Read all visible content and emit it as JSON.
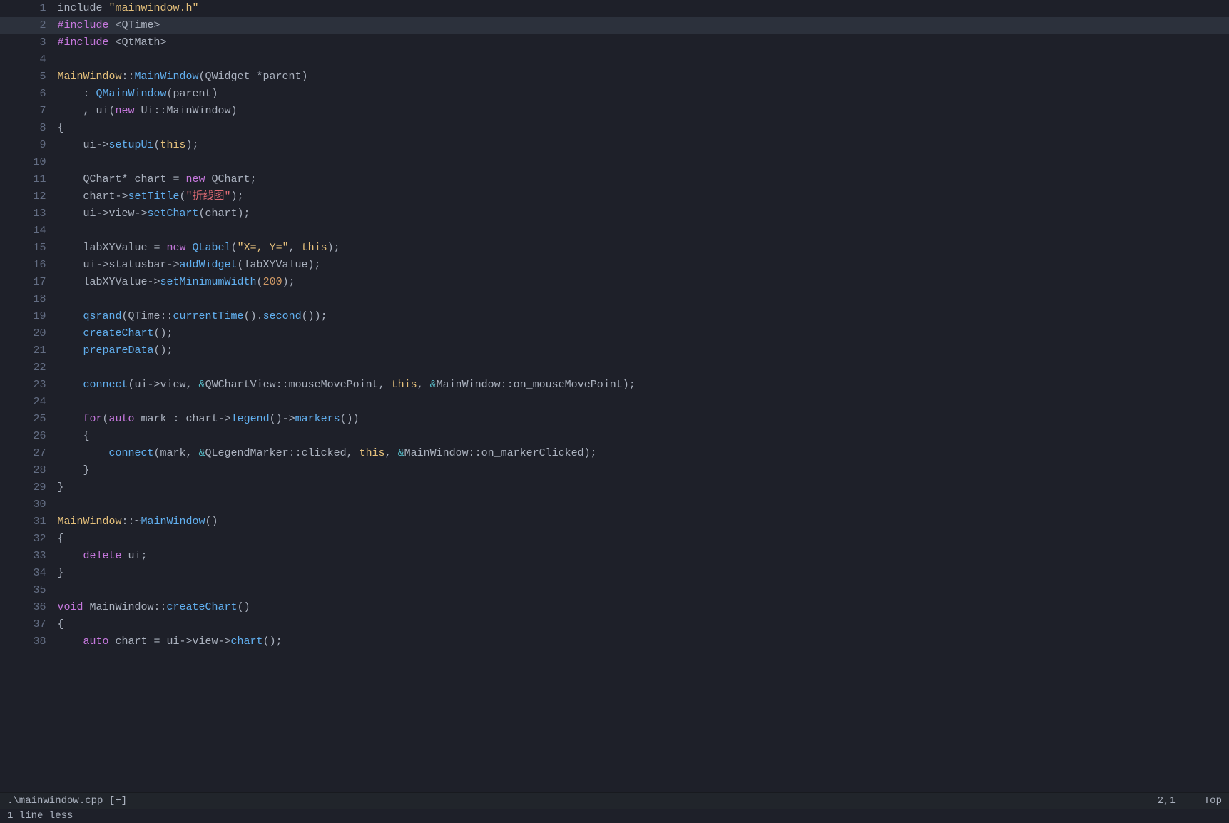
{
  "editor": {
    "filename": ".\\mainwindow.cpp  [+]",
    "position": "2,1",
    "scroll": "Top",
    "bottom_info": "1 line less"
  },
  "lines": [
    {
      "num": 1,
      "content": "include \"mainwindow.h\""
    },
    {
      "num": 2,
      "content": "#include <QTime>",
      "highlighted": true
    },
    {
      "num": 3,
      "content": "#include <QtMath>"
    },
    {
      "num": 4,
      "content": ""
    },
    {
      "num": 5,
      "content": "MainWindow::MainWindow(QWidget *parent)"
    },
    {
      "num": 6,
      "content": "    : QMainWindow(parent)"
    },
    {
      "num": 7,
      "content": "    , ui(new Ui::MainWindow)"
    },
    {
      "num": 8,
      "content": "{"
    },
    {
      "num": 9,
      "content": "    ui->setupUi(this);"
    },
    {
      "num": 10,
      "content": ""
    },
    {
      "num": 11,
      "content": "    QChart* chart = new QChart;"
    },
    {
      "num": 12,
      "content": "    chart->setTitle(\"折线图\");"
    },
    {
      "num": 13,
      "content": "    ui->view->setChart(chart);"
    },
    {
      "num": 14,
      "content": ""
    },
    {
      "num": 15,
      "content": "    labXYValue = new QLabel(\"X=, Y=\", this);"
    },
    {
      "num": 16,
      "content": "    ui->statusbar->addWidget(labXYValue);"
    },
    {
      "num": 17,
      "content": "    labXYValue->setMinimumWidth(200);"
    },
    {
      "num": 18,
      "content": ""
    },
    {
      "num": 19,
      "content": "    qsrand(QTime::currentTime().second());"
    },
    {
      "num": 20,
      "content": "    createChart();"
    },
    {
      "num": 21,
      "content": "    prepareData();"
    },
    {
      "num": 22,
      "content": ""
    },
    {
      "num": 23,
      "content": "    connect(ui->view, &QWChartView::mouseMovePoint, this, &MainWindow::on_mouseMovePoint);"
    },
    {
      "num": 24,
      "content": ""
    },
    {
      "num": 25,
      "content": "    for(auto mark : chart->legend()->markers())"
    },
    {
      "num": 26,
      "content": "    {"
    },
    {
      "num": 27,
      "content": "        connect(mark, &QLegendMarker::clicked, this, &MainWindow::on_markerClicked);"
    },
    {
      "num": 28,
      "content": "    }"
    },
    {
      "num": 29,
      "content": "}"
    },
    {
      "num": 30,
      "content": ""
    },
    {
      "num": 31,
      "content": "MainWindow::~MainWindow()"
    },
    {
      "num": 32,
      "content": "{"
    },
    {
      "num": 33,
      "content": "    delete ui;"
    },
    {
      "num": 34,
      "content": "}"
    },
    {
      "num": 35,
      "content": ""
    },
    {
      "num": 36,
      "content": "void MainWindow::createChart()"
    },
    {
      "num": 37,
      "content": "{"
    },
    {
      "num": 38,
      "content": "    auto chart = ui->view->chart();"
    }
  ]
}
